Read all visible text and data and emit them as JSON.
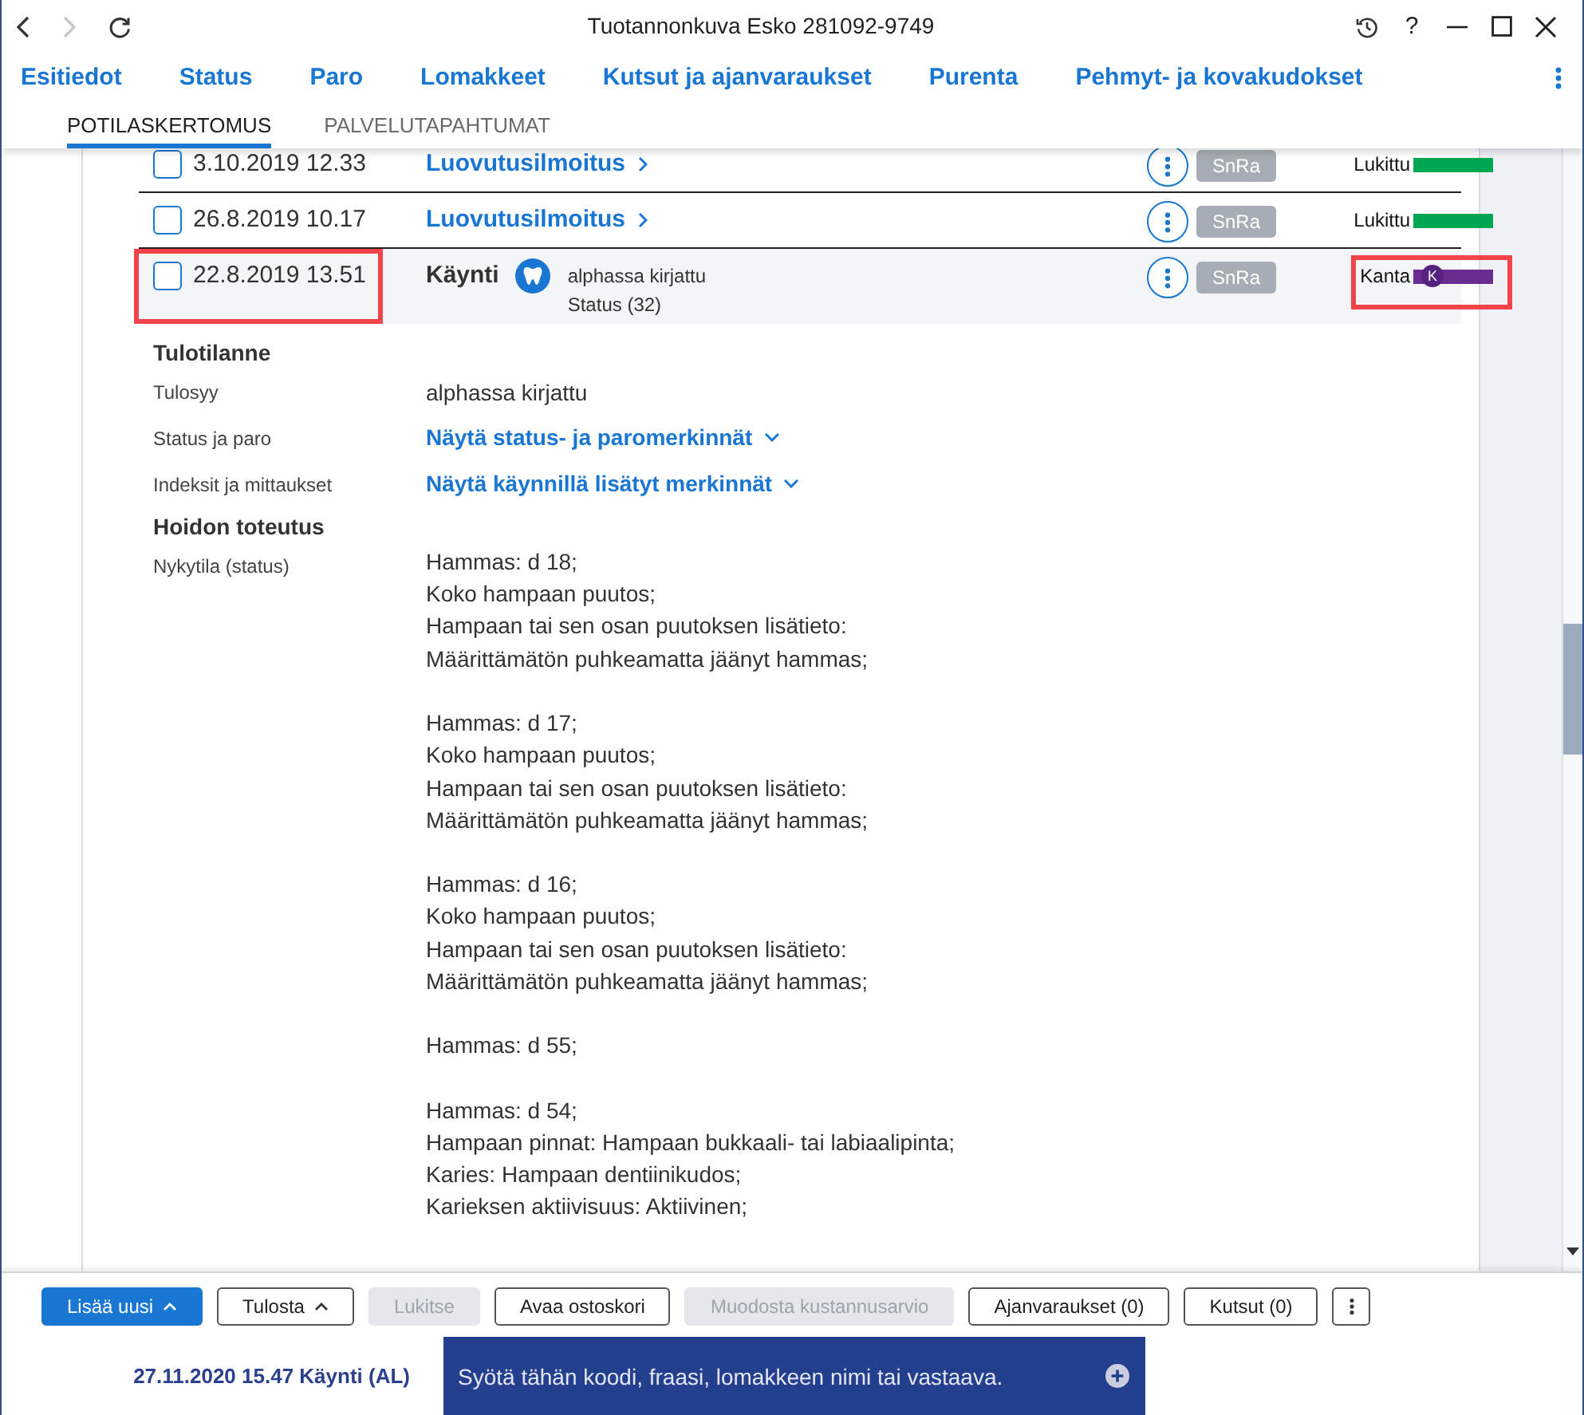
{
  "title_bar": {
    "title": "Tuotannonkuva Esko 281092-9749",
    "nav_buttons": [
      {
        "kind": "back",
        "disabled": false
      },
      {
        "kind": "forward",
        "disabled": true
      },
      {
        "kind": "refresh",
        "disabled": false
      }
    ],
    "window_controls": [
      {
        "kind": "history"
      },
      {
        "kind": "help",
        "label": "?"
      },
      {
        "kind": "minimize"
      },
      {
        "kind": "maximize"
      },
      {
        "kind": "close"
      }
    ]
  },
  "nav": {
    "items": [
      "Esitiedot",
      "Status",
      "Paro",
      "Lomakkeet",
      "Kutsut ja ajanvaraukset",
      "Purenta",
      "Pehmyt- ja kovakudokset"
    ]
  },
  "subtabs": [
    {
      "label": "POTILASKERTOMUS",
      "selected": true
    },
    {
      "label": "PALVELUTAPAHTUMAT",
      "selected": false
    }
  ],
  "entries": [
    {
      "kind": "document",
      "date": "3.10.2019 12.33",
      "checked": false,
      "highlighted": false,
      "title": "Luovutusilmoitus",
      "author": "SnRa",
      "status": {
        "label": "Lukittu",
        "color": "#00a651",
        "highlighted": false
      }
    },
    {
      "kind": "document",
      "date": "26.8.2019 10.17",
      "checked": false,
      "highlighted": false,
      "title": "Luovutusilmoitus",
      "author": "SnRa",
      "status": {
        "label": "Lukittu",
        "color": "#00a651",
        "highlighted": false
      }
    },
    {
      "kind": "visit",
      "date": "22.8.2019 13.51",
      "checked": false,
      "highlighted": true,
      "title": "Käynti",
      "note": "alphassa kirjattu",
      "subnote": "Status (32)",
      "author": "SnRa",
      "status": {
        "label": "Kanta",
        "color": "#6a2c91",
        "badge": "K",
        "highlighted": true
      },
      "details": [
        {
          "kind": "heading",
          "text": "Tulotilanne"
        },
        {
          "kind": "text",
          "label": "Tulosyy",
          "value": "alphassa kirjattu"
        },
        {
          "kind": "link",
          "label": "Status ja paro",
          "value": "Näytä status- ja paromerkinnät"
        },
        {
          "kind": "link",
          "label": "Indeksit ja mittaukset",
          "value": "Näytä käynnillä lisätyt merkinnät"
        },
        {
          "kind": "heading",
          "text": "Hoidon toteutus"
        },
        {
          "kind": "record",
          "label": "Nykytila (status)",
          "paragraphs": [
            [
              "Hammas: d 18;",
              "Koko hampaan puutos;",
              "Hampaan tai sen osan puutoksen lisätieto:",
              "Määrittämätön puhkeamatta jäänyt hammas;"
            ],
            [
              "Hammas: d 17;",
              "Koko hampaan puutos;",
              "Hampaan tai sen osan puutoksen lisätieto:",
              "Määrittämätön puhkeamatta jäänyt hammas;"
            ],
            [
              "Hammas: d 16;",
              "Koko hampaan puutos;",
              "Hampaan tai sen osan puutoksen lisätieto:",
              "Määrittämätön puhkeamatta jäänyt hammas;"
            ],
            [
              "Hammas: d 55;"
            ],
            [
              "Hammas: d 54;",
              "Hampaan pinnat: Hampaan bukkaali- tai labiaalipinta;",
              "Karies: Hampaan dentiinikudos;",
              "Karieksen aktiivisuus: Aktiivinen;"
            ]
          ]
        }
      ]
    }
  ],
  "toolbar": {
    "buttons": [
      {
        "kind": "primary",
        "label": "Lisää uusi",
        "menu": true,
        "disabled": false
      },
      {
        "kind": "outline",
        "label": "Tulosta",
        "menu": true,
        "disabled": false
      },
      {
        "kind": "outline",
        "label": "Lukitse",
        "menu": false,
        "disabled": true
      },
      {
        "kind": "outline",
        "label": "Avaa ostoskori",
        "menu": false,
        "disabled": false
      },
      {
        "kind": "outline",
        "label": "Muodosta kustannusarvio",
        "menu": false,
        "disabled": true
      },
      {
        "kind": "outline",
        "label": "Ajanvaraukset (0)",
        "menu": false,
        "disabled": false
      },
      {
        "kind": "outline",
        "label": "Kutsut (0)",
        "menu": false,
        "disabled": false
      },
      {
        "kind": "more",
        "disabled": false
      }
    ]
  },
  "status_bar": {
    "context": "27.11.2020 15.47 Käynti (AL)",
    "command": {
      "placeholder": "Syötä tähän koodi, fraasi, lomakkeen nimi tai vastaava."
    }
  }
}
